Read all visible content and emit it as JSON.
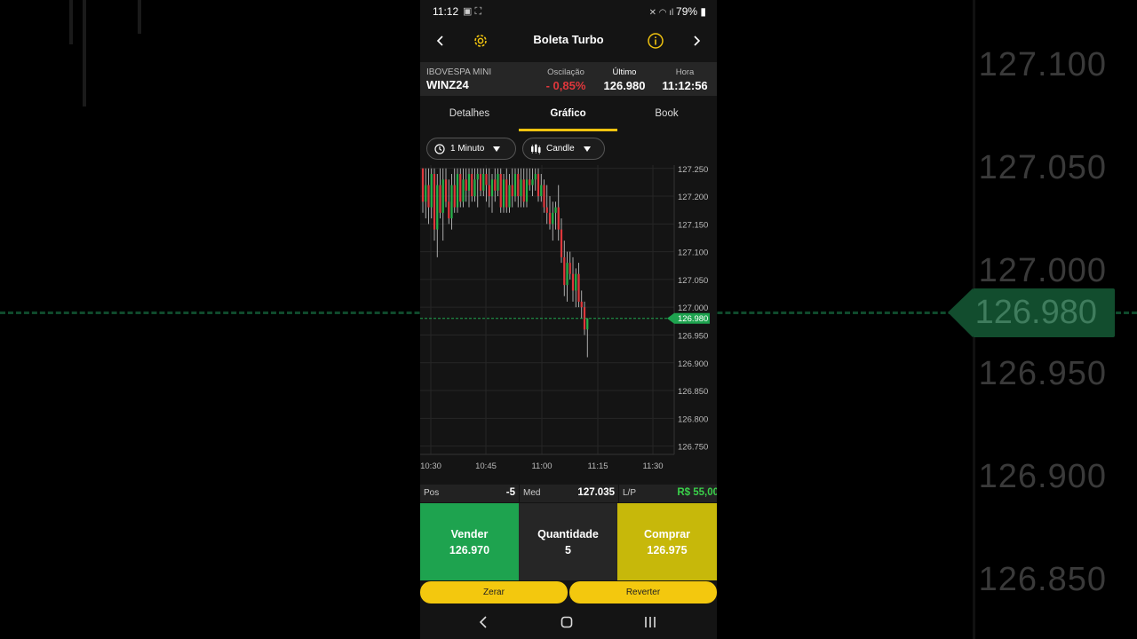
{
  "status_bar": {
    "time": "11:12",
    "battery": "79%"
  },
  "header": {
    "title": "Boleta Turbo"
  },
  "quote": {
    "instrument_name": "IBOVESPA MINI",
    "symbol": "WINZ24",
    "oscillation_label": "Oscilação",
    "oscillation_value": "- 0,85%",
    "last_label": "Último",
    "last_value": "126.980",
    "time_label": "Hora",
    "time_value": "11:12:56"
  },
  "tabs": [
    "Detalhes",
    "Gráfico",
    "Book"
  ],
  "toolbar": {
    "interval": "1 Minuto",
    "chart_type": "Candle"
  },
  "chart_data": {
    "type": "candlestick",
    "y_ticks": [
      "127.250",
      "127.200",
      "127.150",
      "127.100",
      "127.050",
      "127.000",
      "126.950",
      "126.900",
      "126.850",
      "126.800",
      "126.750"
    ],
    "x_ticks": [
      "10:30",
      "10:45",
      "11:00",
      "11:15",
      "11:30"
    ],
    "ylim": [
      126.73,
      127.26
    ],
    "last_price_label": "126.980",
    "last_price": 126.98,
    "candles": [
      [
        127.25,
        127.25,
        127.17,
        127.19
      ],
      [
        127.19,
        127.25,
        127.16,
        127.22
      ],
      [
        127.22,
        127.25,
        127.15,
        127.18
      ],
      [
        127.18,
        127.25,
        127.16,
        127.24
      ],
      [
        127.24,
        127.25,
        127.12,
        127.14
      ],
      [
        127.14,
        127.24,
        127.09,
        127.22
      ],
      [
        127.22,
        127.25,
        127.16,
        127.17
      ],
      [
        127.17,
        127.25,
        127.12,
        127.23
      ],
      [
        127.23,
        127.25,
        127.18,
        127.19
      ],
      [
        127.19,
        127.23,
        127.15,
        127.16
      ],
      [
        127.16,
        127.24,
        127.14,
        127.22
      ],
      [
        127.22,
        127.25,
        127.17,
        127.18
      ],
      [
        127.18,
        127.25,
        127.17,
        127.24
      ],
      [
        127.24,
        127.25,
        127.18,
        127.19
      ],
      [
        127.19,
        127.25,
        127.18,
        127.23
      ],
      [
        127.23,
        127.25,
        127.19,
        127.21
      ],
      [
        127.21,
        127.25,
        127.18,
        127.24
      ],
      [
        127.24,
        127.25,
        127.19,
        127.2
      ],
      [
        127.2,
        127.25,
        127.19,
        127.23
      ],
      [
        127.23,
        127.25,
        127.18,
        127.24
      ],
      [
        127.24,
        127.25,
        127.2,
        127.21
      ],
      [
        127.21,
        127.25,
        127.2,
        127.24
      ],
      [
        127.24,
        127.25,
        127.19,
        127.22
      ],
      [
        127.22,
        127.25,
        127.18,
        127.2
      ],
      [
        127.2,
        127.24,
        127.17,
        127.23
      ],
      [
        127.23,
        127.25,
        127.19,
        127.21
      ],
      [
        127.21,
        127.25,
        127.2,
        127.24
      ],
      [
        127.24,
        127.25,
        127.17,
        127.18
      ],
      [
        127.18,
        127.24,
        127.17,
        127.23
      ],
      [
        127.23,
        127.25,
        127.17,
        127.18
      ],
      [
        127.18,
        127.24,
        127.17,
        127.22
      ],
      [
        127.22,
        127.25,
        127.18,
        127.2
      ],
      [
        127.2,
        127.25,
        127.19,
        127.24
      ],
      [
        127.24,
        127.25,
        127.18,
        127.2
      ],
      [
        127.2,
        127.25,
        127.18,
        127.23
      ],
      [
        127.23,
        127.25,
        127.18,
        127.19
      ],
      [
        127.19,
        127.25,
        127.18,
        127.23
      ],
      [
        127.23,
        127.25,
        127.21,
        127.22
      ],
      [
        127.22,
        127.25,
        127.2,
        127.23
      ],
      [
        127.23,
        127.25,
        127.21,
        127.24
      ],
      [
        127.24,
        127.25,
        127.19,
        127.2
      ],
      [
        127.2,
        127.24,
        127.19,
        127.22
      ],
      [
        127.22,
        127.23,
        127.17,
        127.18
      ],
      [
        127.18,
        127.22,
        127.15,
        127.17
      ],
      [
        127.17,
        127.2,
        127.14,
        127.15
      ],
      [
        127.15,
        127.19,
        127.12,
        127.17
      ],
      [
        127.17,
        127.19,
        127.14,
        127.18
      ],
      [
        127.18,
        127.22,
        127.12,
        127.14
      ],
      [
        127.14,
        127.16,
        127.08,
        127.09
      ],
      [
        127.09,
        127.12,
        127.02,
        127.04
      ],
      [
        127.04,
        127.1,
        127.01,
        127.08
      ],
      [
        127.08,
        127.1,
        127.05,
        127.06
      ],
      [
        127.06,
        127.09,
        127.01,
        127.03
      ],
      [
        127.03,
        127.07,
        127.0,
        127.06
      ],
      [
        127.06,
        127.08,
        127.0,
        127.01
      ],
      [
        127.01,
        127.03,
        126.98,
        127.0
      ],
      [
        127.0,
        127.01,
        126.95,
        126.96
      ],
      [
        126.96,
        126.98,
        126.91,
        126.98
      ]
    ]
  },
  "position_bar": {
    "pos_label": "Pos",
    "pos_value": "-5",
    "med_label": "Med",
    "med_value": "127.035",
    "lp_label": "L/P",
    "lp_value": "R$ 55,00"
  },
  "trade": {
    "sell_label": "Vender",
    "sell_price": "126.970",
    "qty_label": "Quantidade",
    "qty_value": "5",
    "buy_label": "Comprar",
    "buy_price": "126.975"
  },
  "actions": {
    "zerar": "Zerar",
    "reverter": "Reverter"
  },
  "colors": {
    "accent": "#f3c80e",
    "sell": "#1ea34f",
    "buy": "#c7b80a",
    "up": "#26b34b",
    "down": "#e0373c"
  },
  "background_axis": [
    "127.100",
    "127.050",
    "127.000",
    "126.980",
    "126.950",
    "126.900",
    "126.850"
  ]
}
